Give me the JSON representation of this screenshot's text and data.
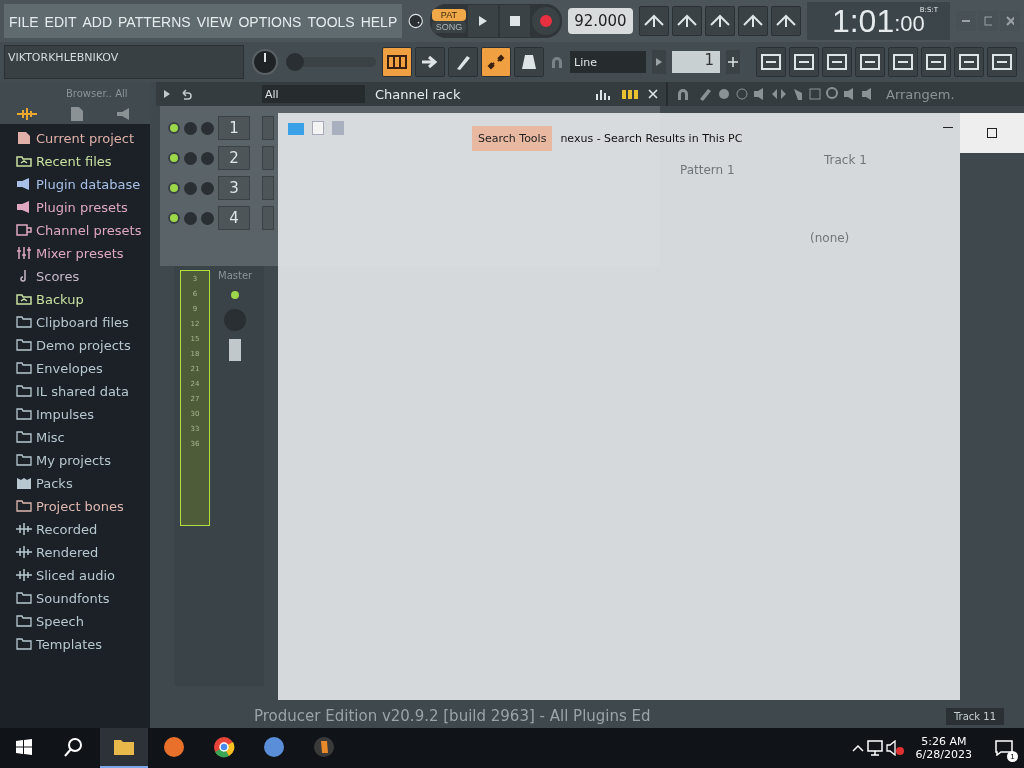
{
  "menu": [
    "FILE",
    "EDIT",
    "ADD",
    "PATTERNS",
    "VIEW",
    "OPTIONS",
    "TOOLS",
    "HELP"
  ],
  "transport": {
    "modes": [
      {
        "label": "PAT",
        "selected": true
      },
      {
        "label": "SONG",
        "selected": false
      }
    ],
    "tempo": "92.000",
    "time_main": "1:01",
    "time_sub": ":00",
    "time_label": "B:S:T"
  },
  "hint_bar": {
    "text": "VIKTORKHLEBNIKOV"
  },
  "pitch": {
    "level": 0
  },
  "toggles": [
    {
      "kind": "keyboard",
      "on": true
    },
    {
      "kind": "arrow",
      "on": false
    },
    {
      "kind": "pen",
      "on": false
    },
    {
      "kind": "link",
      "on": true
    },
    {
      "kind": "metronome",
      "on": false
    }
  ],
  "snap": {
    "value": "Line"
  },
  "pattern": {
    "value": "1"
  },
  "browser": {
    "title": "Browser.. All",
    "items": [
      {
        "label": "Current project",
        "kind": "doc",
        "color": "#e0b0a8"
      },
      {
        "label": "Recent files",
        "kind": "recent",
        "color": "#c8e0a0"
      },
      {
        "label": "Plugin database",
        "kind": "plugin",
        "color": "#a8c0e8"
      },
      {
        "label": "Plugin presets",
        "kind": "plugin",
        "color": "#e0a8c0"
      },
      {
        "label": "Channel presets",
        "kind": "channel",
        "color": "#e0a8c0"
      },
      {
        "label": "Mixer presets",
        "kind": "mixer",
        "color": "#e0a8c0"
      },
      {
        "label": "Scores",
        "kind": "note",
        "color": "#c8b8c8"
      },
      {
        "label": "Backup",
        "kind": "recent",
        "color": "#c8e0a0"
      },
      {
        "label": "Clipboard files",
        "kind": "folder",
        "color": "#b8c8d0"
      },
      {
        "label": "Demo projects",
        "kind": "folder",
        "color": "#b8c8d0"
      },
      {
        "label": "Envelopes",
        "kind": "folder",
        "color": "#b8c8d0"
      },
      {
        "label": "IL shared data",
        "kind": "folder",
        "color": "#b8c8d0"
      },
      {
        "label": "Impulses",
        "kind": "folder",
        "color": "#b8c8d0"
      },
      {
        "label": "Misc",
        "kind": "folder",
        "color": "#b8c8d0"
      },
      {
        "label": "My projects",
        "kind": "folder",
        "color": "#b8c8d0"
      },
      {
        "label": "Packs",
        "kind": "pack",
        "color": "#b8c8d0"
      },
      {
        "label": "Project bones",
        "kind": "folder",
        "color": "#e0b8b0"
      },
      {
        "label": "Recorded",
        "kind": "wave",
        "color": "#b8c8d0"
      },
      {
        "label": "Rendered",
        "kind": "wave",
        "color": "#b8c8d0"
      },
      {
        "label": "Sliced audio",
        "kind": "wave",
        "color": "#b8c8d0"
      },
      {
        "label": "Soundfonts",
        "kind": "folder",
        "color": "#b8c8d0"
      },
      {
        "label": "Speech",
        "kind": "folder",
        "color": "#b8c8d0"
      },
      {
        "label": "Templates",
        "kind": "folder",
        "color": "#b8c8d0"
      }
    ]
  },
  "channel_rack": {
    "filter": "All",
    "title": "Channel rack",
    "channels": [
      {
        "number": "1"
      },
      {
        "number": "2"
      },
      {
        "number": "3"
      },
      {
        "number": "4"
      }
    ]
  },
  "mixer": {
    "scale": [
      "3",
      "6",
      "9",
      "12",
      "15",
      "18",
      "21",
      "24",
      "27",
      "30",
      "33",
      "36"
    ],
    "master": "Master"
  },
  "arrangement": {
    "title": "Arrangem.",
    "pattern": "Pattern 1",
    "track": "Track 1",
    "none": "(none)",
    "last_track": "Track 11"
  },
  "search_window": {
    "tab": "Search Tools",
    "title": "nexus - Search Results in This PC"
  },
  "status": "Producer Edition v20.9.2 [build 2963] - All Plugins Ed",
  "taskbar": {
    "apps": [
      {
        "kind": "explorer",
        "selected": true
      },
      {
        "kind": "firefox",
        "selected": false
      },
      {
        "kind": "chrome",
        "selected": false
      },
      {
        "kind": "qbittorrent",
        "selected": false
      },
      {
        "kind": "flstudio",
        "selected": false
      }
    ],
    "time": "5:26 AM",
    "date": "6/28/2023",
    "notifications": "1"
  }
}
